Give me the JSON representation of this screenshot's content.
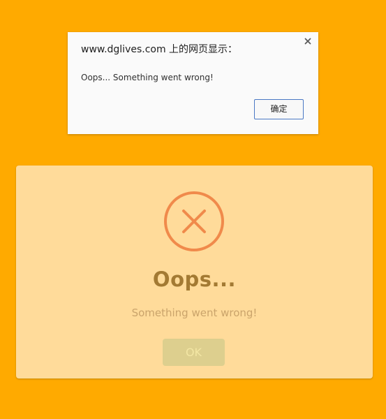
{
  "alert_dialog": {
    "title": "www.dglives.com 上的网页显示：",
    "message": "Oops... Something went wrong!",
    "ok_label": "确定",
    "close_icon": "close-icon"
  },
  "modal": {
    "icon": "error-x-circle-icon",
    "title": "Oops...",
    "text": "Something went wrong!",
    "ok_label": "OK"
  },
  "colors": {
    "page_background": "#ffaa00",
    "modal_background": "#ffdb9a",
    "error_icon": "#f08a4b",
    "modal_title": "#a37a33",
    "modal_text": "#caa46b",
    "modal_button": "#ddcf8e",
    "alert_button_border": "#4a78c4"
  }
}
